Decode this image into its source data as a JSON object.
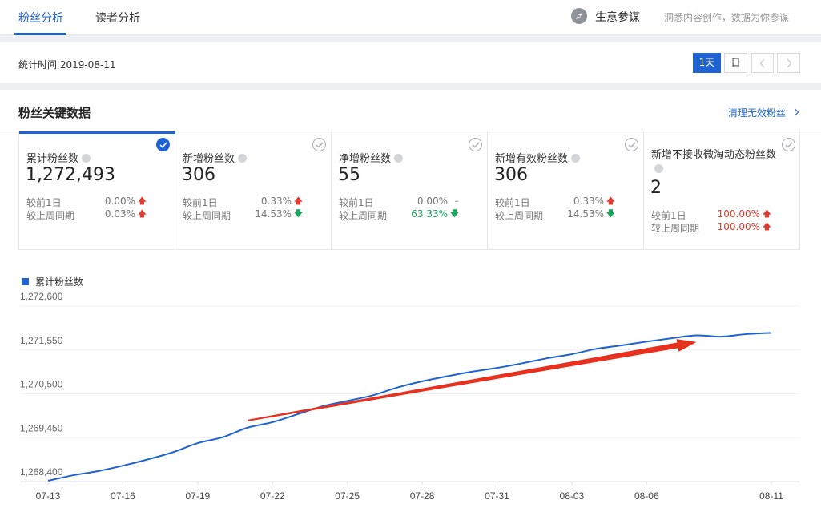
{
  "nav": {
    "tabs": [
      {
        "label": "粉丝分析",
        "active": true
      },
      {
        "label": "读者分析",
        "active": false
      }
    ],
    "brand": {
      "icon": "compass-icon",
      "name": "生意参谋",
      "slogan": "洞悉内容创作，数据为你参谋"
    }
  },
  "date_bar": {
    "label": "统计时间 2019-08-11",
    "buttons": [
      {
        "label": "1天",
        "active": true
      },
      {
        "label": "日",
        "active": false
      }
    ],
    "prev_icon": "chevron-left-icon",
    "next_icon": "chevron-right-icon"
  },
  "panel": {
    "title": "粉丝关键数据",
    "link": "清理无效粉丝"
  },
  "cards": [
    {
      "title": "累计粉丝数",
      "value": "1,272,493",
      "selected": true,
      "rows": [
        {
          "label": "较前1日",
          "value": "0.00%",
          "trend": "up"
        },
        {
          "label": "较上周同期",
          "value": "0.03%",
          "trend": "up"
        }
      ]
    },
    {
      "title": "新增粉丝数",
      "value": "306",
      "selected": false,
      "rows": [
        {
          "label": "较前1日",
          "value": "0.33%",
          "trend": "up"
        },
        {
          "label": "较上周同期",
          "value": "14.53%",
          "trend": "down"
        }
      ]
    },
    {
      "title": "净增粉丝数",
      "value": "55",
      "selected": false,
      "rows": [
        {
          "label": "较前1日",
          "value": "0.00%",
          "trend": "flat"
        },
        {
          "label": "较上周同期",
          "value": "63.33%",
          "trend": "down"
        }
      ]
    },
    {
      "title": "新增有效粉丝数",
      "value": "306",
      "selected": false,
      "rows": [
        {
          "label": "较前1日",
          "value": "0.33%",
          "trend": "up"
        },
        {
          "label": "较上周同期",
          "value": "14.53%",
          "trend": "down"
        }
      ]
    },
    {
      "title": "新增不接收微淘动态粉丝数",
      "value": "2",
      "selected": false,
      "rows": [
        {
          "label": "较前1日",
          "value": "100.00%",
          "trend": "up"
        },
        {
          "label": "较上周同期",
          "value": "100.00%",
          "trend": "up"
        }
      ]
    }
  ],
  "trend_symbols": {
    "up": "🡅",
    "down": "🡇",
    "flat": "–"
  },
  "colors": {
    "accent": "#1f63d3",
    "up": "#e23a2e",
    "down": "#17a65b",
    "annotation": "#e8301f"
  },
  "chart_data": {
    "type": "line",
    "legend_position": "top-left",
    "grid": true,
    "series": [
      {
        "name": "累计粉丝数",
        "color": "#1f63d3",
        "x": [
          "07-13",
          "07-14",
          "07-15",
          "07-16",
          "07-17",
          "07-18",
          "07-19",
          "07-20",
          "07-21",
          "07-22",
          "07-23",
          "07-24",
          "07-25",
          "07-26",
          "07-27",
          "07-28",
          "07-29",
          "07-30",
          "07-31",
          "08-01",
          "08-02",
          "08-03",
          "08-04",
          "08-05",
          "08-06",
          "08-07",
          "08-08",
          "08-09",
          "08-10",
          "08-11"
        ],
        "values": [
          1268420,
          1268550,
          1268650,
          1268780,
          1268930,
          1269100,
          1269320,
          1269460,
          1269690,
          1269820,
          1270010,
          1270200,
          1270330,
          1270460,
          1270650,
          1270800,
          1270920,
          1271030,
          1271120,
          1271230,
          1271350,
          1271450,
          1271580,
          1271660,
          1271750,
          1271830,
          1271900,
          1271870,
          1271930,
          1271960
        ]
      }
    ],
    "x_ticks": [
      "07-13",
      "07-16",
      "07-19",
      "07-22",
      "07-25",
      "07-28",
      "07-31",
      "08-03",
      "08-06",
      "08-11"
    ],
    "y_ticks": [
      "1,268,400",
      "1,269,450",
      "1,270,500",
      "1,271,550",
      "1,272,600"
    ],
    "y_tick_values": [
      1268400,
      1269450,
      1270500,
      1271550,
      1272600
    ],
    "ylim": [
      1268400,
      1272600
    ],
    "annotation": {
      "type": "arrow",
      "color": "#e8301f",
      "from": [
        "07-21",
        1269860
      ],
      "to": [
        "08-08",
        1271740
      ]
    }
  }
}
